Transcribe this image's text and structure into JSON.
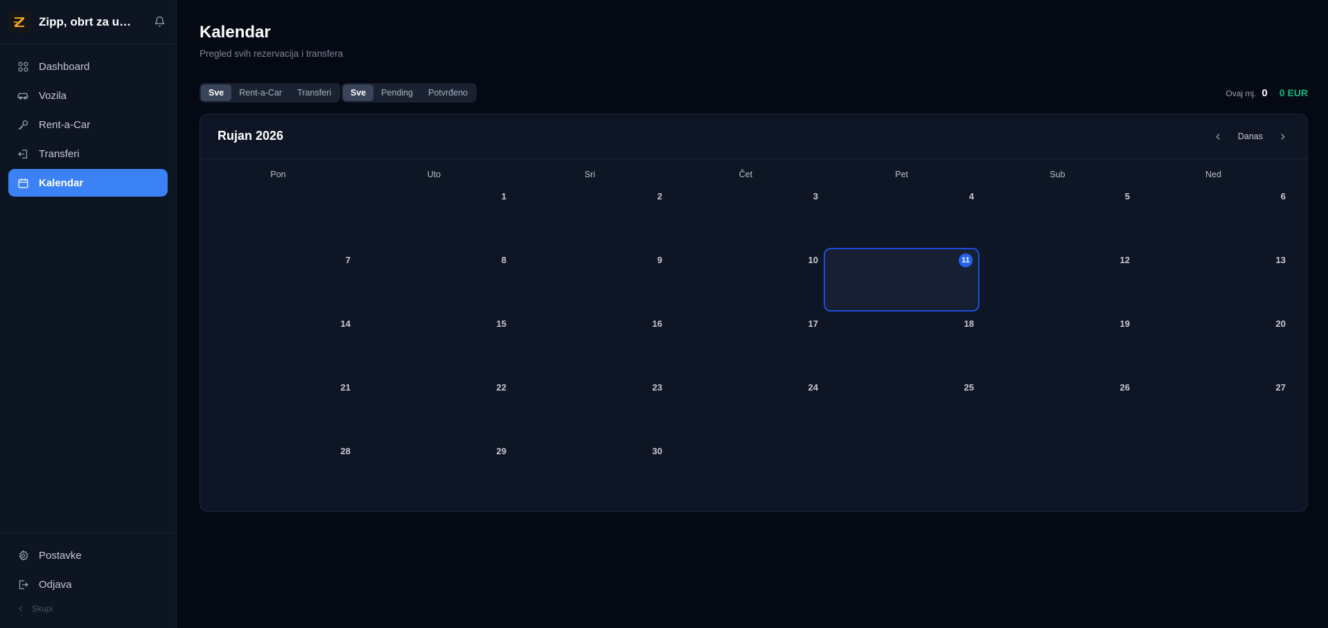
{
  "sidebar": {
    "brand": "Zipp, obrt za usluge",
    "items": [
      {
        "label": "Dashboard",
        "icon": "grid-icon"
      },
      {
        "label": "Vozila",
        "icon": "car-icon"
      },
      {
        "label": "Rent-a-Car",
        "icon": "key-icon"
      },
      {
        "label": "Transferi",
        "icon": "door-arrow-icon"
      },
      {
        "label": "Kalendar",
        "icon": "calendar-icon",
        "active": true
      }
    ],
    "bottom": [
      {
        "label": "Postavke",
        "icon": "gear-icon"
      },
      {
        "label": "Odjava",
        "icon": "logout-icon"
      }
    ],
    "collapse": "Skupi"
  },
  "page": {
    "title": "Kalendar",
    "subtitle": "Pregled svih rezervacija i transfera"
  },
  "filters": {
    "type": [
      "Sve",
      "Rent-a-Car",
      "Transferi"
    ],
    "status": [
      "Sve",
      "Pending",
      "Potvrđeno"
    ]
  },
  "stats": {
    "label": "Ovaj mj.",
    "count": "0",
    "total": "0 EUR"
  },
  "calendar": {
    "month": "Rujan 2026",
    "today_label": "Danas",
    "weekdays": [
      "Pon",
      "Uto",
      "Sri",
      "Čet",
      "Pet",
      "Sub",
      "Ned"
    ],
    "weeks": [
      [
        "",
        "1",
        "2",
        "3",
        "4",
        "5",
        "6"
      ],
      [
        "7",
        "8",
        "9",
        "10",
        "11",
        "12",
        "13"
      ],
      [
        "14",
        "15",
        "16",
        "17",
        "18",
        "19",
        "20"
      ],
      [
        "21",
        "22",
        "23",
        "24",
        "25",
        "26",
        "27"
      ],
      [
        "28",
        "29",
        "30",
        "",
        "",
        "",
        ""
      ]
    ],
    "today": "11"
  },
  "colors": {
    "accent": "#3b82f6",
    "success": "#10b981",
    "brand_logo": "#f5a623"
  }
}
